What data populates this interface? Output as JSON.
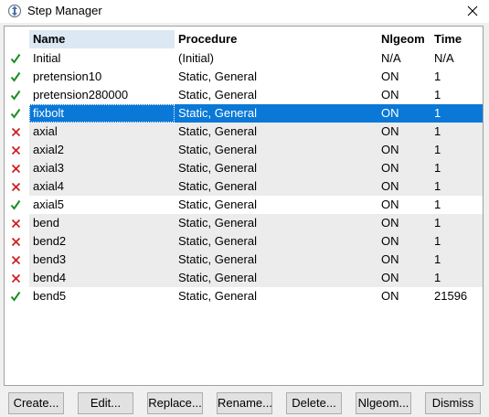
{
  "window": {
    "title": "Step Manager",
    "icon": "step-manager-icon"
  },
  "table": {
    "headers": {
      "name": "Name",
      "procedure": "Procedure",
      "nlgeom": "Nlgeom",
      "time": "Time"
    },
    "rows": [
      {
        "status": "valid",
        "name": "Initial",
        "procedure": "(Initial)",
        "nlgeom": "N/A",
        "time": "N/A"
      },
      {
        "status": "valid",
        "name": "pretension10",
        "procedure": "Static, General",
        "nlgeom": "ON",
        "time": "1"
      },
      {
        "status": "valid",
        "name": "pretension280000",
        "procedure": "Static, General",
        "nlgeom": "ON",
        "time": "1"
      },
      {
        "status": "valid",
        "name": "fixbolt",
        "procedure": "Static, General",
        "nlgeom": "ON",
        "time": "1",
        "selected": true
      },
      {
        "status": "invalid",
        "name": "axial",
        "procedure": "Static, General",
        "nlgeom": "ON",
        "time": "1"
      },
      {
        "status": "invalid",
        "name": "axial2",
        "procedure": "Static, General",
        "nlgeom": "ON",
        "time": "1"
      },
      {
        "status": "invalid",
        "name": "axial3",
        "procedure": "Static, General",
        "nlgeom": "ON",
        "time": "1"
      },
      {
        "status": "invalid",
        "name": "axial4",
        "procedure": "Static, General",
        "nlgeom": "ON",
        "time": "1"
      },
      {
        "status": "valid",
        "name": "axial5",
        "procedure": "Static, General",
        "nlgeom": "ON",
        "time": "1"
      },
      {
        "status": "invalid",
        "name": "bend",
        "procedure": "Static, General",
        "nlgeom": "ON",
        "time": "1"
      },
      {
        "status": "invalid",
        "name": "bend2",
        "procedure": "Static, General",
        "nlgeom": "ON",
        "time": "1"
      },
      {
        "status": "invalid",
        "name": "bend3",
        "procedure": "Static, General",
        "nlgeom": "ON",
        "time": "1"
      },
      {
        "status": "invalid",
        "name": "bend4",
        "procedure": "Static, General",
        "nlgeom": "ON",
        "time": "1"
      },
      {
        "status": "valid",
        "name": "bend5",
        "procedure": "Static, General",
        "nlgeom": "ON",
        "time": "21596"
      }
    ]
  },
  "buttons": {
    "create": "Create...",
    "edit": "Edit...",
    "replace": "Replace...",
    "rename": "Rename...",
    "delete": "Delete...",
    "nlgeom": "Nlgeom...",
    "dismiss": "Dismiss"
  },
  "colors": {
    "selection": "#0a78d7",
    "valid_mark": "#1e8c1e",
    "invalid_mark": "#d21f1f",
    "header_highlight": "#dce8f3"
  },
  "icons": {
    "valid": "check-mark-icon",
    "invalid": "x-mark-icon",
    "close": "close-icon"
  }
}
